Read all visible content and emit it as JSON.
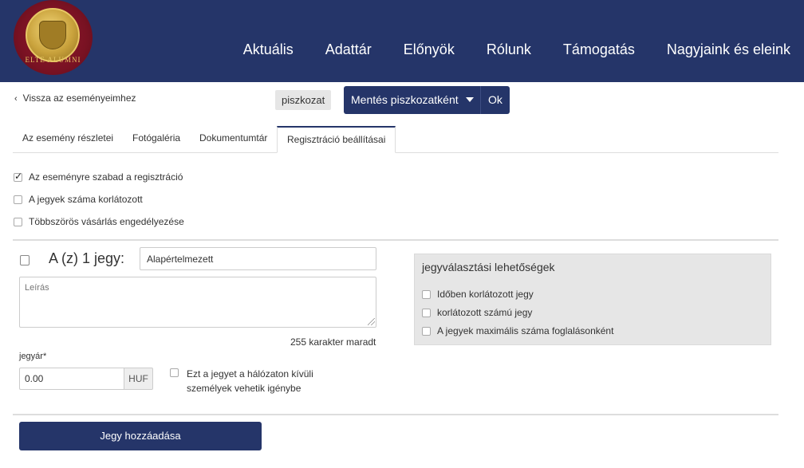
{
  "header": {
    "logo_text": "ELTE ALUMNI",
    "nav": [
      "Aktuális",
      "Adattár",
      "Előnyök",
      "Rólunk",
      "Támogatás",
      "Nagyjaink és eleink"
    ],
    "background_color": "#253569"
  },
  "toolbar": {
    "back_label": "Vissza az eseményeimhez",
    "status_badge": "piszkozat",
    "save_draft_label": "Mentés piszkozatként",
    "ok_label": "Ok"
  },
  "tabs": [
    {
      "label": "Az esemény részletei",
      "active": false
    },
    {
      "label": "Fotógaléria",
      "active": false
    },
    {
      "label": "Dokumentumtár",
      "active": false
    },
    {
      "label": "Regisztráció beállításai",
      "active": true
    }
  ],
  "registration_options": [
    {
      "label": "Az eseményre szabad a regisztráció",
      "checked": true
    },
    {
      "label": "A jegyek száma korlátozott",
      "checked": false
    },
    {
      "label": "Többszörös vásárlás engedélyezése",
      "checked": false
    }
  ],
  "ticket": {
    "label": "A (z) 1 jegy:",
    "name_value": "Alapértelmezett",
    "description_placeholder": "Leírás",
    "remaining_chars": "255 karakter maradt",
    "price_label": "jegyár*",
    "price_value": "0.00",
    "currency": "HUF",
    "outside_network_label": "Ezt a jegyet a hálózaton kívüli személyek vehetik igénybe",
    "outside_network_checked": false
  },
  "ticket_options_panel": {
    "title": "jegyválasztási lehetőségek",
    "options": [
      {
        "label": "Időben korlátozott jegy",
        "checked": false
      },
      {
        "label": "korlátozott számú jegy",
        "checked": false
      },
      {
        "label": "A jegyek maximális száma foglalásonként",
        "checked": false
      }
    ]
  },
  "add_ticket_label": "Jegy hozzáadása"
}
